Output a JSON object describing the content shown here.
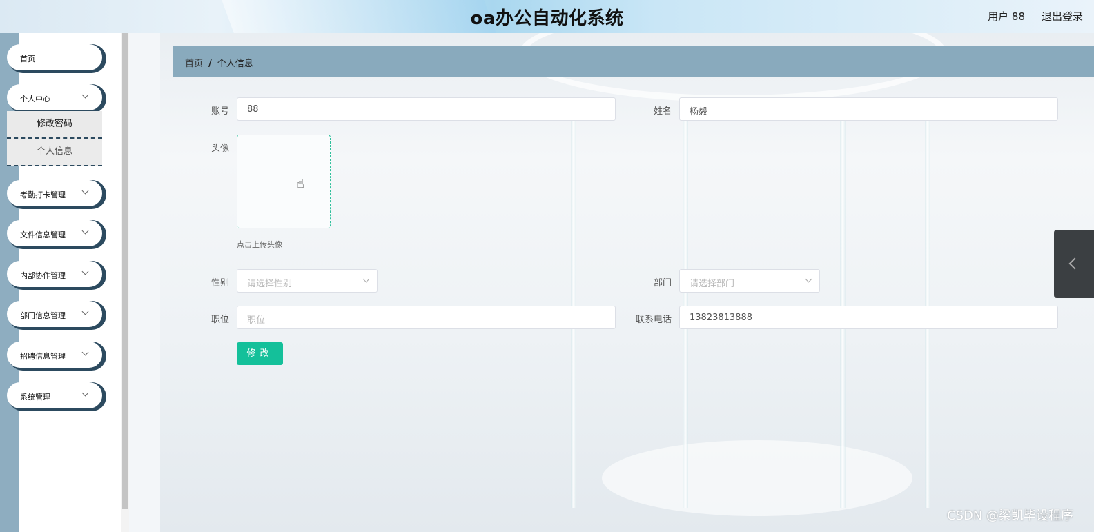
{
  "header": {
    "title": "oa办公自动化系统",
    "user": "用户 88",
    "logout": "退出登录"
  },
  "sidebar": {
    "items": [
      {
        "label": "首页",
        "has_arrow": false
      },
      {
        "label": "个人中心",
        "has_arrow": true,
        "expanded": true,
        "children": [
          {
            "label": "修改密码"
          },
          {
            "label": "个人信息",
            "active": true
          }
        ]
      },
      {
        "label": "考勤打卡管理",
        "has_arrow": true
      },
      {
        "label": "文件信息管理",
        "has_arrow": true
      },
      {
        "label": "内部协作管理",
        "has_arrow": true
      },
      {
        "label": "部门信息管理",
        "has_arrow": true
      },
      {
        "label": "招聘信息管理",
        "has_arrow": true
      },
      {
        "label": "系统管理",
        "has_arrow": true
      }
    ]
  },
  "breadcrumb": {
    "home": "首页",
    "separator": "/",
    "current": "个人信息"
  },
  "form": {
    "account": {
      "label": "账号",
      "value": "88"
    },
    "name": {
      "label": "姓名",
      "value": "杨毅"
    },
    "avatar": {
      "label": "头像",
      "hint": "点击上传头像"
    },
    "gender": {
      "label": "性别",
      "placeholder": "请选择性别"
    },
    "department": {
      "label": "部门",
      "placeholder": "请选择部门"
    },
    "position": {
      "label": "职位",
      "placeholder": "职位"
    },
    "phone": {
      "label": "联系电话",
      "value": "13823813888"
    },
    "submit": "修改"
  },
  "watermark": "CSDN @梁凯毕设程序",
  "colors": {
    "accent": "#14c09a",
    "sidebar_shadow": "#2c4a5f",
    "breadcrumb_bg": "#89aabd"
  }
}
